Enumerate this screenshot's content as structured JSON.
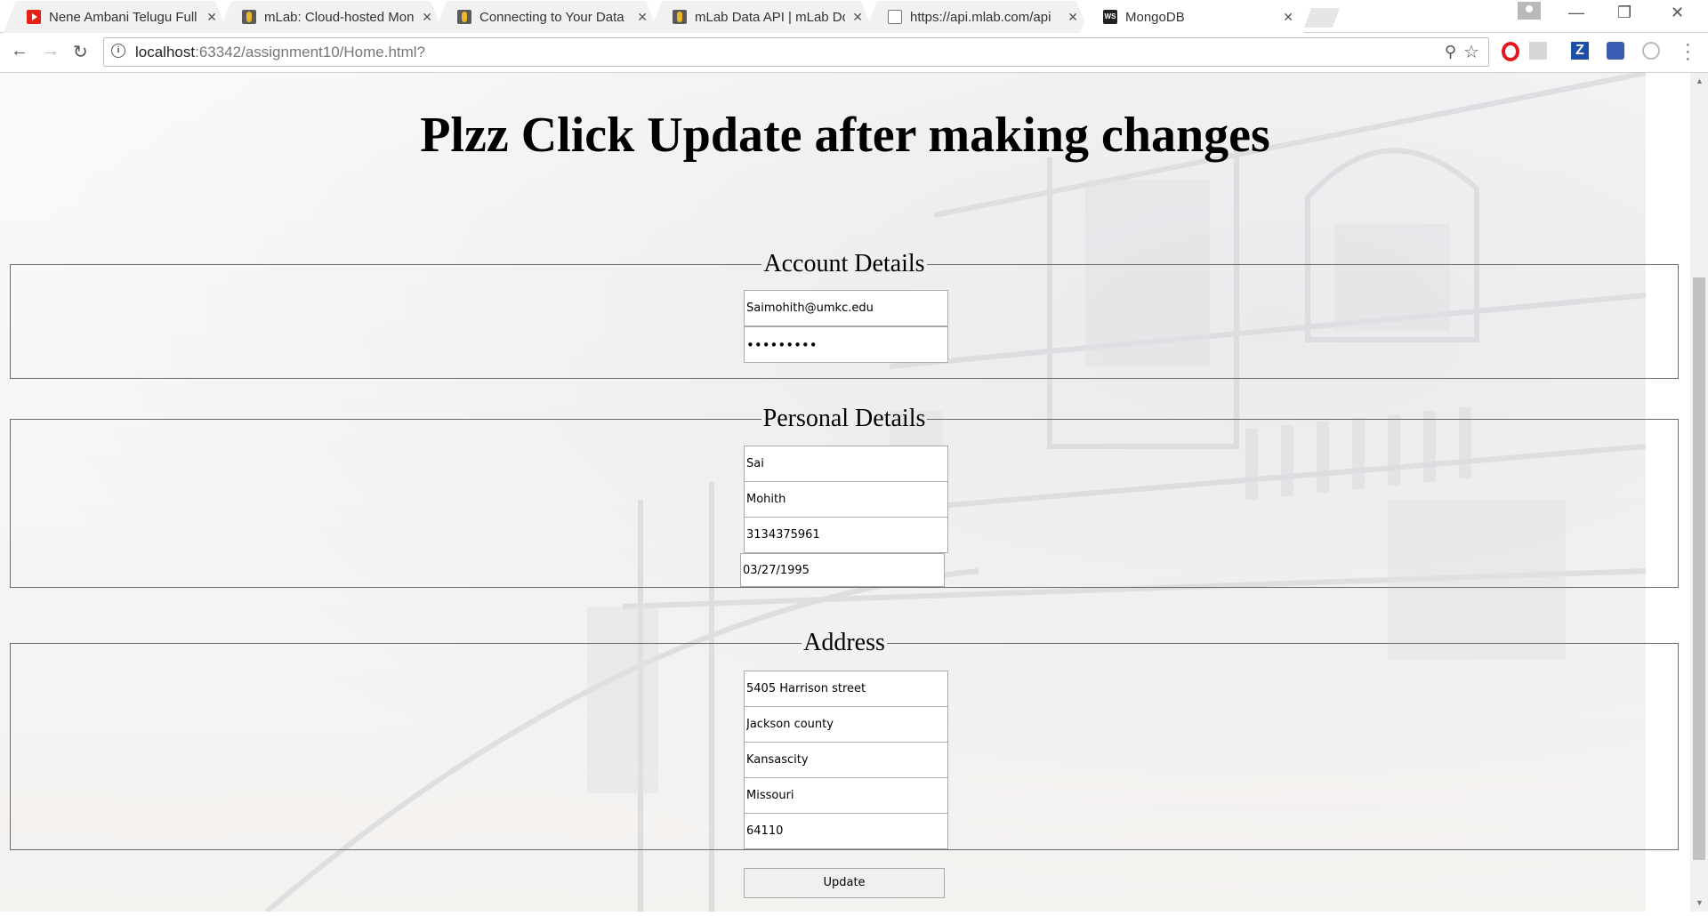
{
  "browser": {
    "tabs": [
      {
        "title": "Nene Ambani Telugu Full",
        "favicon": "youtube-icon",
        "active": false
      },
      {
        "title": "mLab: Cloud-hosted Mon",
        "favicon": "mlab-icon",
        "active": false
      },
      {
        "title": "Connecting to Your Data",
        "favicon": "mlab-icon",
        "active": false
      },
      {
        "title": "mLab Data API | mLab Do",
        "favicon": "mlab-icon",
        "active": false
      },
      {
        "title": "https://api.mlab.com/api",
        "favicon": "document-icon",
        "active": false
      },
      {
        "title": "MongoDB",
        "favicon": "webstorm-icon",
        "active": true
      }
    ],
    "url_host": "localhost",
    "url_path": ":63342/assignment10/Home.html?"
  },
  "page": {
    "heading": "Plzz Click Update after making changes",
    "account": {
      "legend": "Account Details",
      "email": "Saimohith@umkc.edu",
      "password": "•••••••••"
    },
    "personal": {
      "legend": "Personal Details",
      "first_name": "Sai",
      "last_name": "Mohith",
      "phone": "3134375961",
      "dob": "03/27/1995"
    },
    "address": {
      "legend": "Address",
      "street": "5405 Harrison street",
      "county": "Jackson county",
      "city": "Kansascity",
      "state": "Missouri",
      "zip": "64110"
    },
    "update_label": "Update"
  }
}
